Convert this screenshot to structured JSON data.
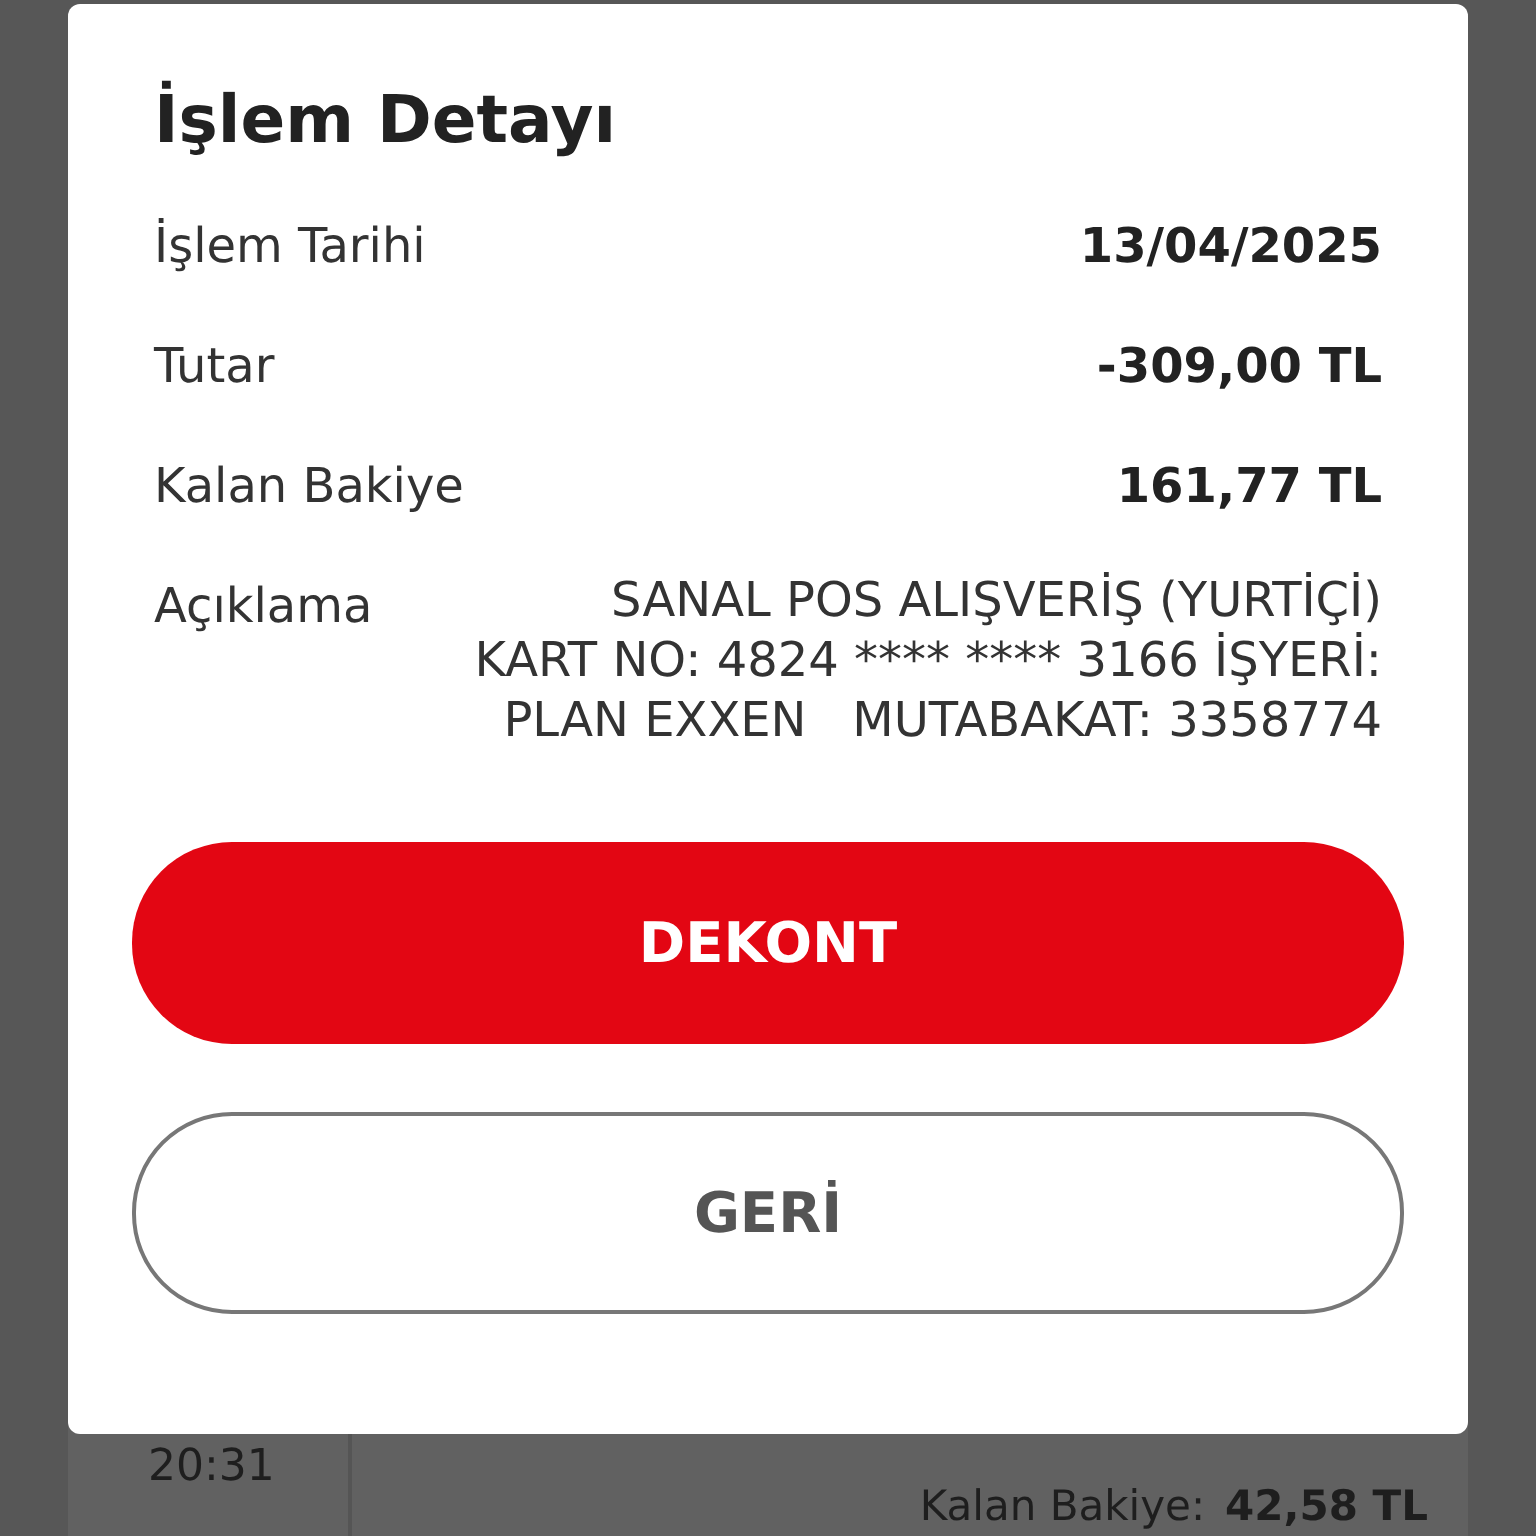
{
  "dialog": {
    "title": "İşlem Detayı",
    "rows": [
      {
        "label": "İşlem Tarihi",
        "value": "13/04/2025"
      },
      {
        "label": "Tutar",
        "value": "-309,00 TL"
      },
      {
        "label": "Kalan Bakiye",
        "value": "161,77 TL"
      }
    ],
    "description": {
      "label": "Açıklama",
      "lines": [
        "SANAL POS ALIŞVERİŞ (YURTİÇİ)",
        "KART NO: 4824 **** **** 3166 İŞYERİ:",
        "PLAN EXXEN   MUTABAKAT: 3358774"
      ]
    },
    "buttons": [
      {
        "label": "DEKONT",
        "kind": "primary"
      },
      {
        "label": "GERİ",
        "kind": "outline"
      }
    ]
  },
  "background_row": {
    "time": "20:31",
    "balance_label": "Kalan Bakiye:",
    "balance_value": "42,58 TL"
  }
}
